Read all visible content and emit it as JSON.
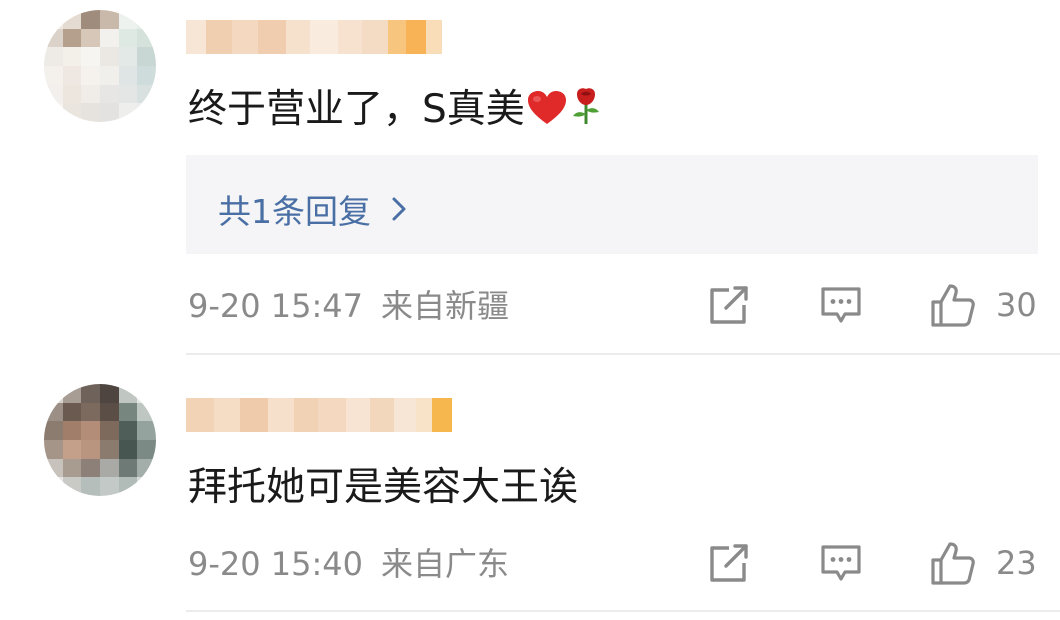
{
  "comments": [
    {
      "text": "终于营业了，S真美",
      "emojis": [
        "heart",
        "rose"
      ],
      "reply_label": "共1条回复",
      "timestamp": "9-20 15:47",
      "location": "来自新疆",
      "like_count": "30"
    },
    {
      "text": "拜托她可是美容大王诶",
      "emojis": [],
      "timestamp": "9-20 15:40",
      "location": "来自广东",
      "like_count": "23"
    }
  ],
  "icons": {
    "share": "share-icon",
    "comment": "comment-icon",
    "like": "thumbs-up-icon",
    "reply_chevron": "chevron-right-icon"
  },
  "colors": {
    "text": "#1a1a1a",
    "meta": "#8a8a8a",
    "reply_link": "#4a6fa5",
    "reply_bg": "#f5f5f7",
    "divider": "#ececec"
  }
}
